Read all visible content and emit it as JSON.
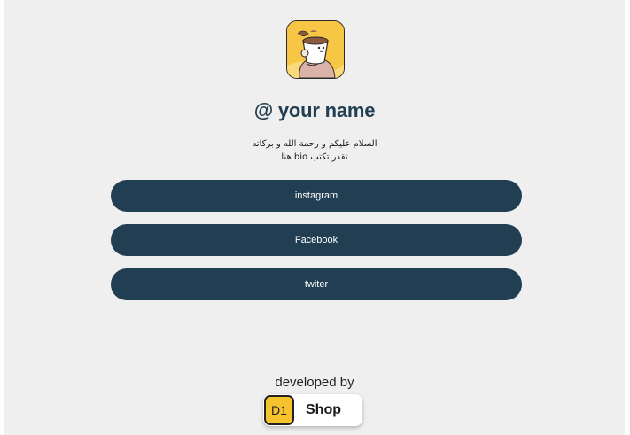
{
  "profile": {
    "avatar_icon": "coffee-cup-character-avatar",
    "username": "@ your name",
    "bio_line1": "السلام عليكم و رحمة الله و بركاته",
    "bio_line2": "تقدر تكتب bio هنا"
  },
  "links": [
    {
      "label": "instagram"
    },
    {
      "label": "Facebook"
    },
    {
      "label": "twiter"
    }
  ],
  "footer": {
    "developed_by": "developed by",
    "badge_logo": "D1",
    "badge_label": "Shop"
  },
  "colors": {
    "background": "#efefef",
    "primary": "#213e52",
    "button_text": "#ffffff",
    "badge_yellow": "#f6c22e"
  }
}
